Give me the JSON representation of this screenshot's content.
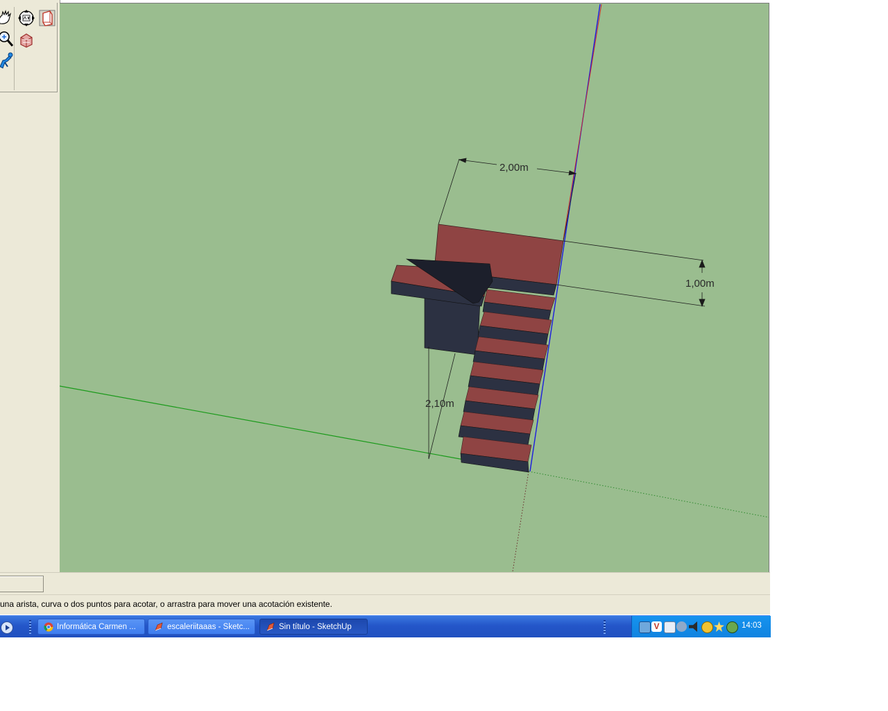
{
  "toolbar": {
    "tools": [
      {
        "name": "pan-icon"
      },
      {
        "name": "orbit-icon"
      },
      {
        "name": "section-plane-icon"
      },
      {
        "name": "zoom-icon"
      },
      {
        "name": "section-cut-icon"
      },
      {
        "name": "walk-icon"
      }
    ]
  },
  "viewport": {
    "background": "#9abd8f",
    "dimensions": [
      {
        "label": "2,00m"
      },
      {
        "label": "1,00m"
      },
      {
        "label": "2,10m"
      }
    ],
    "axes": {
      "red": "#c8302e",
      "green": "#1a9a1a",
      "blue": "#1c1ce0"
    },
    "materials": {
      "tread": "#8f4443",
      "riser": "#2c3142"
    }
  },
  "status": {
    "hint": "una arista, curva o dos puntos para acotar, o arrastra para mover una acotación existente."
  },
  "taskbar": {
    "buttons": [
      {
        "label": "Informática Carmen ...",
        "icon": "chrome-icon",
        "active": false
      },
      {
        "label": "escaleriitaaas - Sketc...",
        "icon": "sketchup-icon",
        "active": false
      },
      {
        "label": "Sin título - SketchUp",
        "icon": "sketchup-icon",
        "active": true
      }
    ],
    "tray_icons": [
      "network-icon",
      "antivirus-icon",
      "messenger-icon",
      "updates-icon",
      "volume-icon",
      "security-icon",
      "star-icon",
      "printer-icon"
    ],
    "clock": "14:03"
  }
}
